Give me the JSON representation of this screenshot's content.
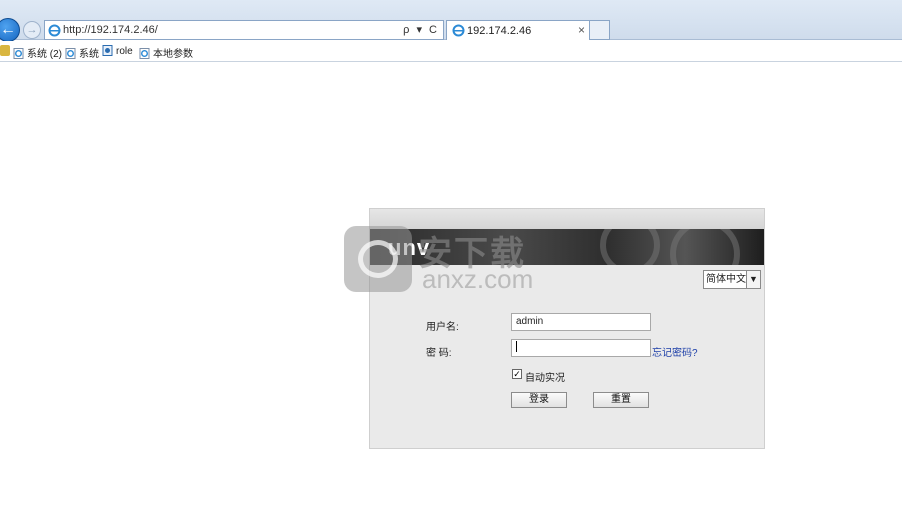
{
  "browser": {
    "address": "http://192.174.2.46/",
    "address_tools": "ρ ▾ C",
    "tab_title": "192.174.2.46",
    "tab_close": "×",
    "back_glyph": "←",
    "forward_glyph": "→",
    "favorites": [
      {
        "label": "系统 (2)",
        "icon": "ie-page-icon"
      },
      {
        "label": "系统",
        "icon": "ie-page-icon"
      },
      {
        "label": "role",
        "icon": "page-icon"
      },
      {
        "label": "本地参数",
        "icon": "ie-page-icon"
      }
    ]
  },
  "login": {
    "brand": "unv",
    "language": "简体中文",
    "language_arrow": "▼",
    "username_label": "用户名:",
    "username_value": "admin",
    "password_label": "密  码:",
    "forgot_password": "忘记密码?",
    "auto_label": "自动实况",
    "auto_checked": "✓",
    "login_button": "登录",
    "reset_button": "重置"
  },
  "watermark": {
    "cn": "安下载",
    "en": "anxz.com"
  },
  "colors": {
    "accent": "#1565c0",
    "link": "#1c3ea8",
    "banner": "#2a2a2a"
  }
}
